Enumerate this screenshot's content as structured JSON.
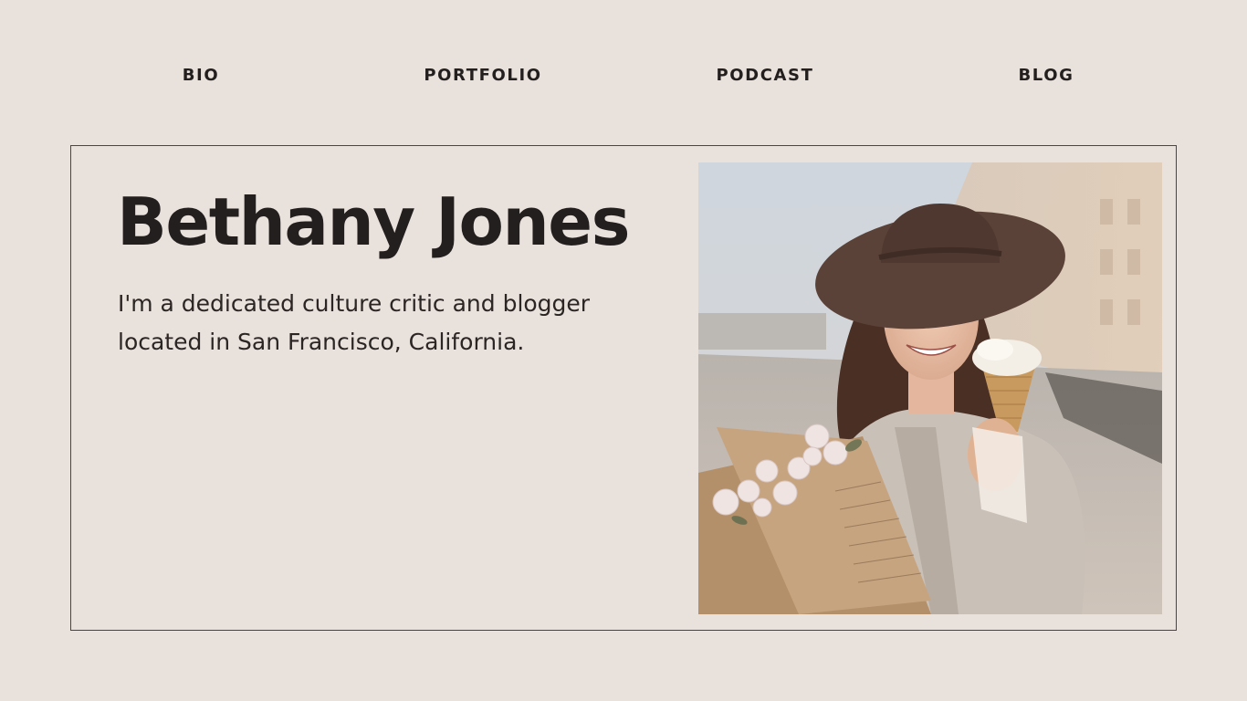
{
  "nav": {
    "bio": "BIO",
    "portfolio": "PORTFOLIO",
    "podcast": "PODCAST",
    "blog": "BLOG"
  },
  "hero": {
    "name": "Bethany Jones",
    "tagline_line1": "I'm a dedicated culture critic and blogger",
    "tagline_line2": "located in San Francisco, California."
  },
  "colors": {
    "background": "#e9e1dc",
    "text": "#231f1e",
    "border": "#4a4442"
  }
}
